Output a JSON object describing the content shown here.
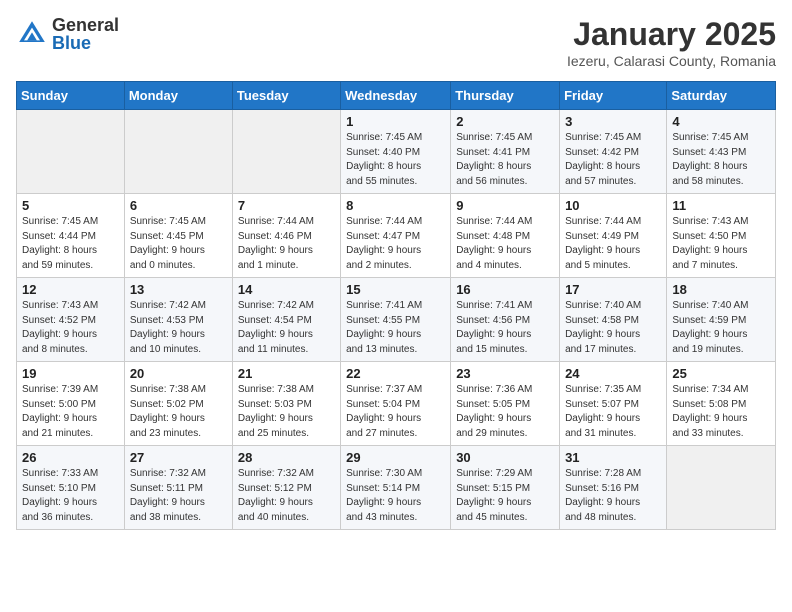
{
  "header": {
    "logo_general": "General",
    "logo_blue": "Blue",
    "month_title": "January 2025",
    "location": "Iezeru, Calarasi County, Romania"
  },
  "weekdays": [
    "Sunday",
    "Monday",
    "Tuesday",
    "Wednesday",
    "Thursday",
    "Friday",
    "Saturday"
  ],
  "weeks": [
    [
      {
        "day": "",
        "info": ""
      },
      {
        "day": "",
        "info": ""
      },
      {
        "day": "",
        "info": ""
      },
      {
        "day": "1",
        "info": "Sunrise: 7:45 AM\nSunset: 4:40 PM\nDaylight: 8 hours\nand 55 minutes."
      },
      {
        "day": "2",
        "info": "Sunrise: 7:45 AM\nSunset: 4:41 PM\nDaylight: 8 hours\nand 56 minutes."
      },
      {
        "day": "3",
        "info": "Sunrise: 7:45 AM\nSunset: 4:42 PM\nDaylight: 8 hours\nand 57 minutes."
      },
      {
        "day": "4",
        "info": "Sunrise: 7:45 AM\nSunset: 4:43 PM\nDaylight: 8 hours\nand 58 minutes."
      }
    ],
    [
      {
        "day": "5",
        "info": "Sunrise: 7:45 AM\nSunset: 4:44 PM\nDaylight: 8 hours\nand 59 minutes."
      },
      {
        "day": "6",
        "info": "Sunrise: 7:45 AM\nSunset: 4:45 PM\nDaylight: 9 hours\nand 0 minutes."
      },
      {
        "day": "7",
        "info": "Sunrise: 7:44 AM\nSunset: 4:46 PM\nDaylight: 9 hours\nand 1 minute."
      },
      {
        "day": "8",
        "info": "Sunrise: 7:44 AM\nSunset: 4:47 PM\nDaylight: 9 hours\nand 2 minutes."
      },
      {
        "day": "9",
        "info": "Sunrise: 7:44 AM\nSunset: 4:48 PM\nDaylight: 9 hours\nand 4 minutes."
      },
      {
        "day": "10",
        "info": "Sunrise: 7:44 AM\nSunset: 4:49 PM\nDaylight: 9 hours\nand 5 minutes."
      },
      {
        "day": "11",
        "info": "Sunrise: 7:43 AM\nSunset: 4:50 PM\nDaylight: 9 hours\nand 7 minutes."
      }
    ],
    [
      {
        "day": "12",
        "info": "Sunrise: 7:43 AM\nSunset: 4:52 PM\nDaylight: 9 hours\nand 8 minutes."
      },
      {
        "day": "13",
        "info": "Sunrise: 7:42 AM\nSunset: 4:53 PM\nDaylight: 9 hours\nand 10 minutes."
      },
      {
        "day": "14",
        "info": "Sunrise: 7:42 AM\nSunset: 4:54 PM\nDaylight: 9 hours\nand 11 minutes."
      },
      {
        "day": "15",
        "info": "Sunrise: 7:41 AM\nSunset: 4:55 PM\nDaylight: 9 hours\nand 13 minutes."
      },
      {
        "day": "16",
        "info": "Sunrise: 7:41 AM\nSunset: 4:56 PM\nDaylight: 9 hours\nand 15 minutes."
      },
      {
        "day": "17",
        "info": "Sunrise: 7:40 AM\nSunset: 4:58 PM\nDaylight: 9 hours\nand 17 minutes."
      },
      {
        "day": "18",
        "info": "Sunrise: 7:40 AM\nSunset: 4:59 PM\nDaylight: 9 hours\nand 19 minutes."
      }
    ],
    [
      {
        "day": "19",
        "info": "Sunrise: 7:39 AM\nSunset: 5:00 PM\nDaylight: 9 hours\nand 21 minutes."
      },
      {
        "day": "20",
        "info": "Sunrise: 7:38 AM\nSunset: 5:02 PM\nDaylight: 9 hours\nand 23 minutes."
      },
      {
        "day": "21",
        "info": "Sunrise: 7:38 AM\nSunset: 5:03 PM\nDaylight: 9 hours\nand 25 minutes."
      },
      {
        "day": "22",
        "info": "Sunrise: 7:37 AM\nSunset: 5:04 PM\nDaylight: 9 hours\nand 27 minutes."
      },
      {
        "day": "23",
        "info": "Sunrise: 7:36 AM\nSunset: 5:05 PM\nDaylight: 9 hours\nand 29 minutes."
      },
      {
        "day": "24",
        "info": "Sunrise: 7:35 AM\nSunset: 5:07 PM\nDaylight: 9 hours\nand 31 minutes."
      },
      {
        "day": "25",
        "info": "Sunrise: 7:34 AM\nSunset: 5:08 PM\nDaylight: 9 hours\nand 33 minutes."
      }
    ],
    [
      {
        "day": "26",
        "info": "Sunrise: 7:33 AM\nSunset: 5:10 PM\nDaylight: 9 hours\nand 36 minutes."
      },
      {
        "day": "27",
        "info": "Sunrise: 7:32 AM\nSunset: 5:11 PM\nDaylight: 9 hours\nand 38 minutes."
      },
      {
        "day": "28",
        "info": "Sunrise: 7:32 AM\nSunset: 5:12 PM\nDaylight: 9 hours\nand 40 minutes."
      },
      {
        "day": "29",
        "info": "Sunrise: 7:30 AM\nSunset: 5:14 PM\nDaylight: 9 hours\nand 43 minutes."
      },
      {
        "day": "30",
        "info": "Sunrise: 7:29 AM\nSunset: 5:15 PM\nDaylight: 9 hours\nand 45 minutes."
      },
      {
        "day": "31",
        "info": "Sunrise: 7:28 AM\nSunset: 5:16 PM\nDaylight: 9 hours\nand 48 minutes."
      },
      {
        "day": "",
        "info": ""
      }
    ]
  ]
}
